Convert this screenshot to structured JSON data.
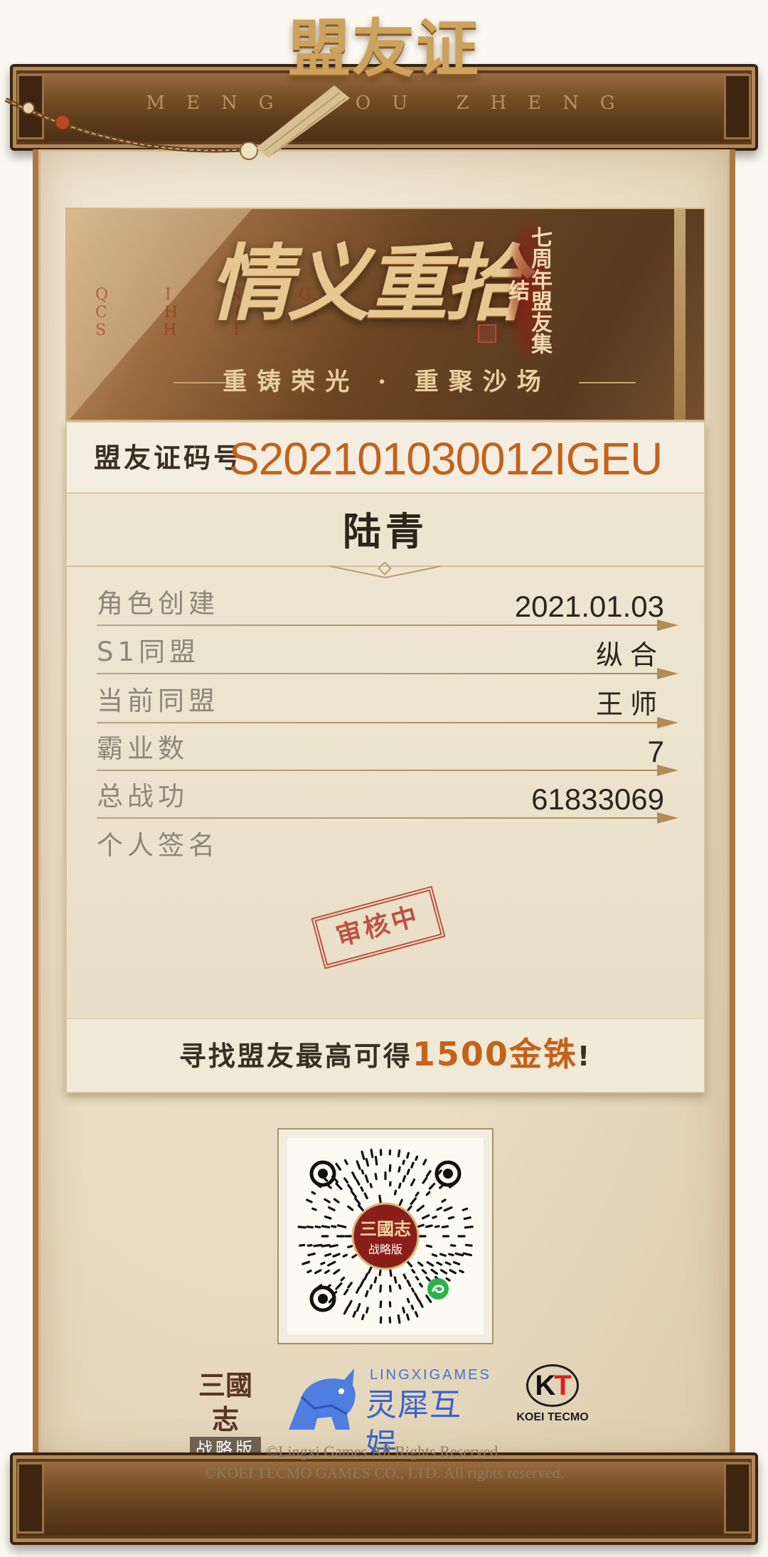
{
  "header": {
    "title": "盟友证",
    "pinyin": "MENG YOU ZHENG"
  },
  "banner": {
    "title": "情义重拾",
    "pinyin": "QING YI CHONG SHI",
    "badge": "七周年盟友集结",
    "slogan": "重铸荣光 · 重聚沙场"
  },
  "card": {
    "code_label": "盟友证码号",
    "code_value": "S202101030012IGEU",
    "player_name": "陆青",
    "rows": [
      {
        "label": "角色创建",
        "value": "2021.01.03"
      },
      {
        "label": "S1同盟",
        "value": "纵合"
      },
      {
        "label": "当前同盟",
        "value": "王师"
      },
      {
        "label": "霸业数",
        "value": "7"
      },
      {
        "label": "总战功",
        "value": "61833069"
      }
    ],
    "signature_label": "个人签名",
    "stamp": "审核中",
    "promo_prefix": "寻找盟友最高可得",
    "promo_highlight": "1500金铢",
    "promo_suffix": "!"
  },
  "qr": {
    "center_title": "三國志",
    "center_subtitle": "战略版"
  },
  "logos": {
    "sgz_title": "三國志",
    "sgz_subtitle": "战略版",
    "lingxi_en": "LINGXIGAMES",
    "lingxi_cn": "灵犀互娱",
    "koei_mark_k": "K",
    "koei_mark_t": "T",
    "koei_name": "KOEI TECMO"
  },
  "footer": {
    "line1": "©Lingxi Games.All Rights Reserved.",
    "line2": "©KOEI TECMO GAMES CO., LTD. All rights reserved."
  },
  "colors": {
    "accent_orange": "#c4621a",
    "wood_dark": "#5c3a1c",
    "stamp_red": "#b63a2b",
    "text_dark": "#2b2520"
  }
}
